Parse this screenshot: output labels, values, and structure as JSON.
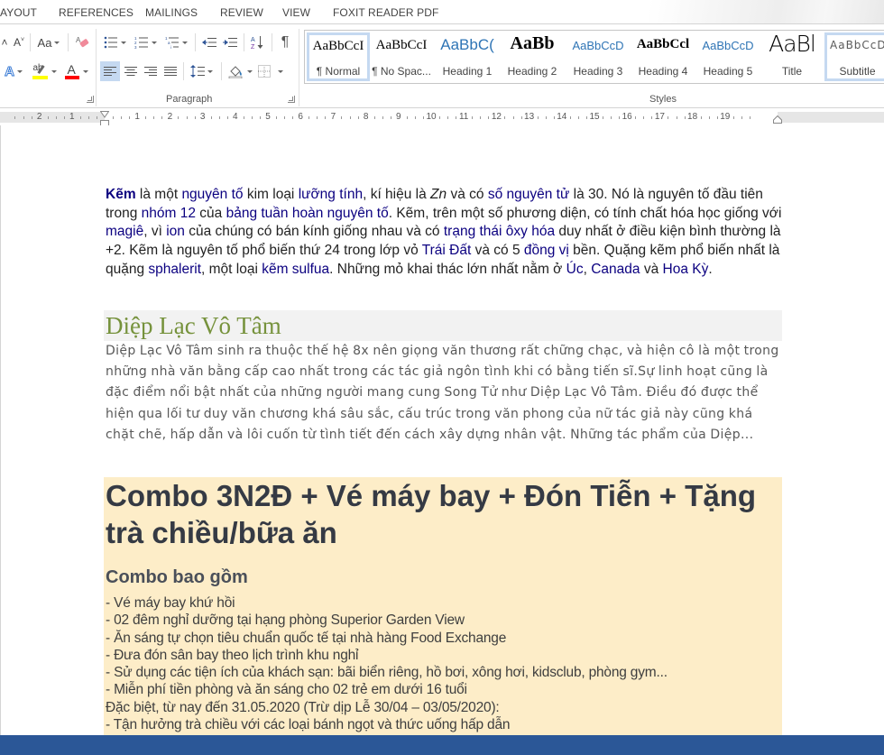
{
  "tabs": [
    "AYOUT",
    "REFERENCES",
    "MAILINGS",
    "REVIEW",
    "VIEW",
    "FOXIT READER PDF"
  ],
  "ribbon": {
    "font_group": {
      "grow_font": "A˄",
      "shrink_font": "A˅",
      "change_case": "Aa",
      "text_effects": "A",
      "highlight": "ab",
      "font_color": "A",
      "highlight_color": "#ffff00",
      "font_color_value": "#ff0000"
    },
    "paragraph_group": {
      "label": "Paragraph",
      "show_marks": "¶",
      "sort": "A↓Z",
      "active_alignment": "align-left"
    },
    "styles_group": {
      "label": "Styles",
      "items": [
        {
          "sample": "AaBbCcI",
          "name": "¶ Normal",
          "selected": true
        },
        {
          "sample": "AaBbCcI",
          "name": "¶ No Spac...",
          "selected": false
        },
        {
          "sample": "AaBbC(",
          "name": "Heading 1",
          "selected": false
        },
        {
          "sample": "AaBb",
          "name": "Heading 2",
          "selected": false
        },
        {
          "sample": "AaBbCcD",
          "name": "Heading 3",
          "selected": false
        },
        {
          "sample": "AaBbCcl",
          "name": "Heading 4",
          "selected": false
        },
        {
          "sample": "AaBbCcD",
          "name": "Heading 5",
          "selected": false
        },
        {
          "sample": "AaBl",
          "name": "Title",
          "selected": false
        },
        {
          "sample": "AaBbCcD",
          "name": "Subtitle",
          "selected": false
        }
      ]
    }
  },
  "ruler": {
    "left_numbers": [
      "2",
      "1"
    ],
    "right_numbers": [
      "1",
      "2",
      "3",
      "4",
      "5",
      "6",
      "7",
      "8",
      "9",
      "10",
      "11",
      "12",
      "13",
      "14",
      "15",
      "16",
      "17",
      "18",
      "19"
    ]
  },
  "document": {
    "para1": {
      "k1": "Kẽm",
      "t1": " là một ",
      "l1": "nguyên tố",
      "t2": " kim loại ",
      "l2": "lưỡng tính",
      "t3": ", kí hiệu là ",
      "i1": "Zn",
      "t4": " và có ",
      "l3": "số nguyên tử",
      "t5": " là 30. Nó là nguyên tố đầu tiên trong ",
      "l4": "nhóm 12",
      "t6": " của ",
      "l5": "bảng tuần hoàn nguyên tố",
      "t7": ". Kẽm, trên một số phương diện, có tính chất hóa học giống với ",
      "l6": "magiê",
      "t8": ", vì ",
      "l7": "ion",
      "t9": " của chúng có bán kính giống nhau và có ",
      "l8": "trạng thái ôxy hóa",
      "t10": " duy nhất ở điều kiện bình thường là +2. Kẽm là nguyên tố phổ biến thứ 24 trong lớp vỏ ",
      "l9": "Trái Đất",
      "t11": " và có 5 ",
      "l10": "đồng vị",
      "t12": " bền. Quặng kẽm phổ biến nhất là quặng ",
      "l11": "sphalerit",
      "t13": ", một loại ",
      "l12": "kẽm sulfua",
      "t14": ". Những mỏ khai thác lớn nhất nằm ở ",
      "l13": "Úc",
      "t15": ", ",
      "l14": "Canada",
      "t16": " và ",
      "l15": "Hoa Kỳ",
      "t17": "."
    },
    "heading_diep": "Diệp Lạc Vô Tâm",
    "para2": "Diệp Lạc Vô Tâm sinh ra thuộc thế hệ 8x nên giọng văn thương rất chững chạc, và hiện cô là một trong những nhà văn bằng cấp cao nhất trong các tác giả ngôn tình khi có bằng tiến sĩ.Sự linh hoạt cũng là đặc điểm nổi bật nhất của những người mang cung Song Tử như Diệp Lạc Vô Tâm. Điều đó được thể hiện qua  lối tư duy văn chương khá sâu sắc, cấu trúc trong văn phong của nữ tác giả này cũng khá chặt chẽ, hấp dẫn và lôi cuốn từ tình tiết đến cách xây dựng nhân vật. Những tác phẩm của Diệp...",
    "combo": {
      "title": "Combo 3N2Đ + Vé máy bay + Đón Tiễn + Tặng trà chiều/bữa ăn",
      "subtitle": "Combo bao gồm",
      "lines": [
        "- Vé máy bay khứ hồi",
        "- 02 đêm nghỉ dưỡng tại hạng phòng Superior Garden View",
        "- Ăn sáng tự chọn tiêu chuẩn quốc tế tại nhà hàng Food Exchange",
        "- Đưa đón sân bay theo lịch trình khu nghỉ",
        "- Sử dụng các tiện ích của khách sạn: bãi biển riêng, hồ bơi, xông hơi, kidsclub, phòng gym...",
        "- Miễn phí tiền phòng và ăn sáng cho 02 trẻ em dưới 16 tuổi",
        "Đặc biệt, từ nay đến 31.05.2020 (Trừ dịp Lễ 30/04 – 03/05/2020):",
        "- Tận hưởng trà chiều với các loại bánh ngọt và thức uống hấp dẫn"
      ]
    }
  },
  "colors": {
    "link": "#0b0080",
    "heading_green": "#76923c",
    "combo_bg": "#fdedc8",
    "statusbar": "#2b5797",
    "selection": "#c5d9f1"
  }
}
